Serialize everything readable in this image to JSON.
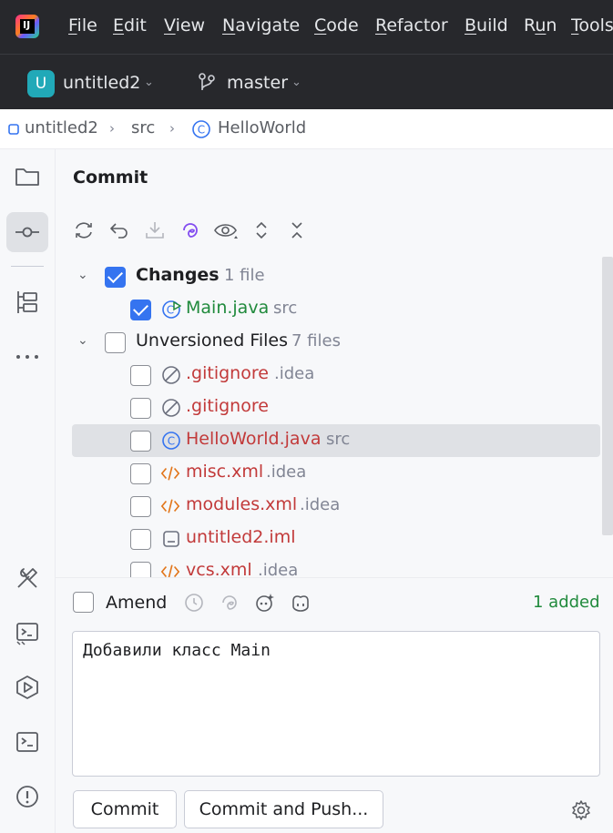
{
  "menubar": {
    "items": [
      {
        "pre": "",
        "u": "F",
        "rest": "ile"
      },
      {
        "pre": "",
        "u": "E",
        "rest": "dit"
      },
      {
        "pre": "",
        "u": "V",
        "rest": "iew"
      },
      {
        "pre": "",
        "u": "N",
        "rest": "avigate"
      },
      {
        "pre": "",
        "u": "C",
        "rest": "ode"
      },
      {
        "pre": "",
        "u": "R",
        "rest": "efactor"
      },
      {
        "pre": "",
        "u": "B",
        "rest": "uild"
      },
      {
        "pre": "R",
        "u": "u",
        "rest": "n"
      },
      {
        "pre": "",
        "u": "T",
        "rest": "ools"
      }
    ]
  },
  "toolbar": {
    "project_badge": "U",
    "project_name": "untitled2",
    "branch_name": "master"
  },
  "breadcrumb": {
    "project": "untitled2",
    "folder": "src",
    "file": "HelloWorld"
  },
  "commit_panel": {
    "title": "Commit",
    "groups": [
      {
        "label": "Changes",
        "count": "1 file"
      },
      {
        "label": "Unversioned Files",
        "count": "7 files"
      }
    ],
    "files": [
      {
        "name": "Main.java",
        "hint": "src"
      },
      {
        "name": ".gitignore",
        "hint": ".idea"
      },
      {
        "name": ".gitignore",
        "hint": ""
      },
      {
        "name": "HelloWorld.java",
        "hint": "src"
      },
      {
        "name": "misc.xml",
        "hint": ".idea"
      },
      {
        "name": "modules.xml",
        "hint": ".idea"
      },
      {
        "name": "untitled2.iml",
        "hint": ""
      },
      {
        "name": "vcs.xml",
        "hint": ".idea"
      }
    ],
    "amend_label": "Amend",
    "status": "1 added",
    "message": "Добавили класс Main",
    "commit_button": "Commit",
    "commit_push_button": "Commit and Push..."
  },
  "colors": {
    "accent": "#3574f0",
    "added_file": "#208a3c",
    "unversioned_file": "#c23a3a",
    "xml_icon": "#e2761b"
  }
}
